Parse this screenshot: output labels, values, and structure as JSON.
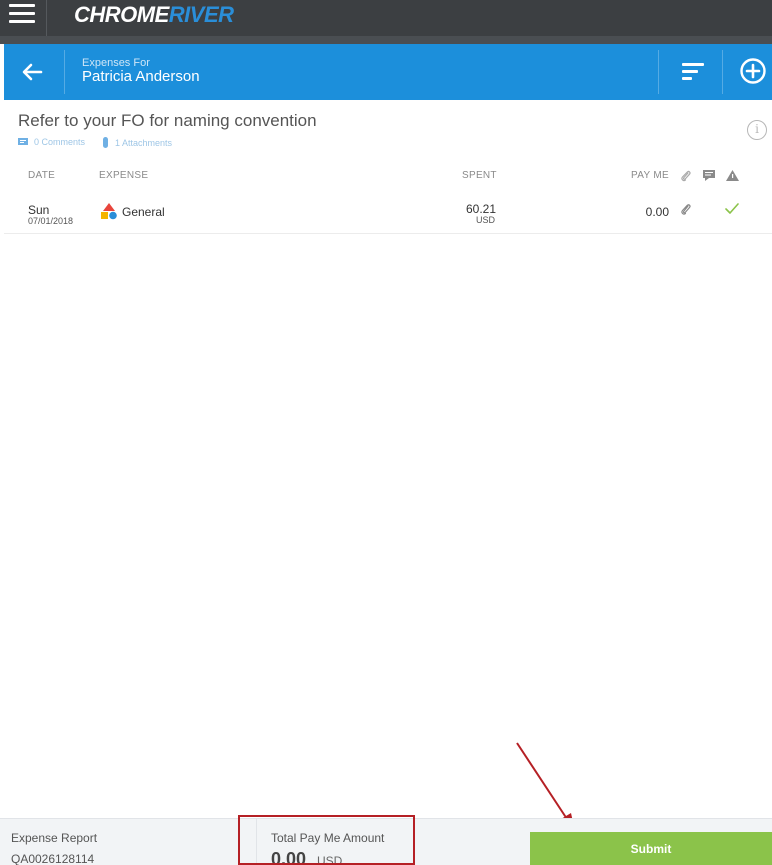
{
  "app": {
    "brand_part1": "CHROME",
    "brand_part2": "RIVER"
  },
  "header": {
    "subtitle": "Expenses For",
    "title": "Patricia Anderson"
  },
  "report": {
    "name": "Refer to your FO for naming convention",
    "comments": "0 Comments",
    "attachments": "1 Attachments"
  },
  "table": {
    "columns": {
      "date": "DATE",
      "expense": "EXPENSE",
      "spent": "SPENT",
      "pay_me": "PAY ME"
    },
    "rows": [
      {
        "day": "Sun",
        "date": "07/01/2018",
        "expense": "General",
        "spent": "60.21",
        "currency": "USD",
        "pay_me": "0.00",
        "status": "approved"
      }
    ]
  },
  "footer": {
    "report_label": "Expense Report",
    "report_id": "QA0026128114",
    "total_label": "Total Pay Me Amount",
    "total_value": "0.00",
    "total_currency": "USD",
    "submit_label": "Submit"
  },
  "colors": {
    "brand_blue": "#1c8fdb",
    "submit_green": "#8bc34a",
    "topbar": "#3c3f42",
    "annotation_red": "#b52025"
  }
}
